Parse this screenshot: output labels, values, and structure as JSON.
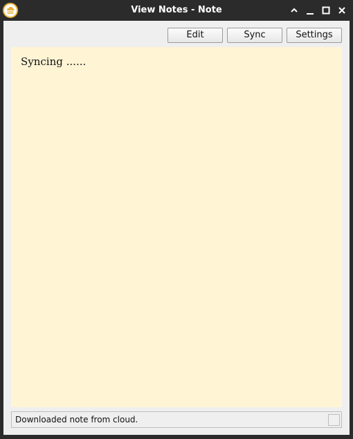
{
  "window": {
    "title": "View Notes - Note",
    "icon": "cloud-note-icon"
  },
  "toolbar": {
    "edit_label": "Edit",
    "sync_label": "Sync",
    "settings_label": "Settings"
  },
  "note": {
    "content": "Syncing ......",
    "background_color": "#fff4d4"
  },
  "status": {
    "message": "Downloaded note from cloud."
  },
  "colors": {
    "titlebar": "#2b2b2b",
    "window_bg": "#efefef",
    "icon_accent": "#e8b13a"
  }
}
